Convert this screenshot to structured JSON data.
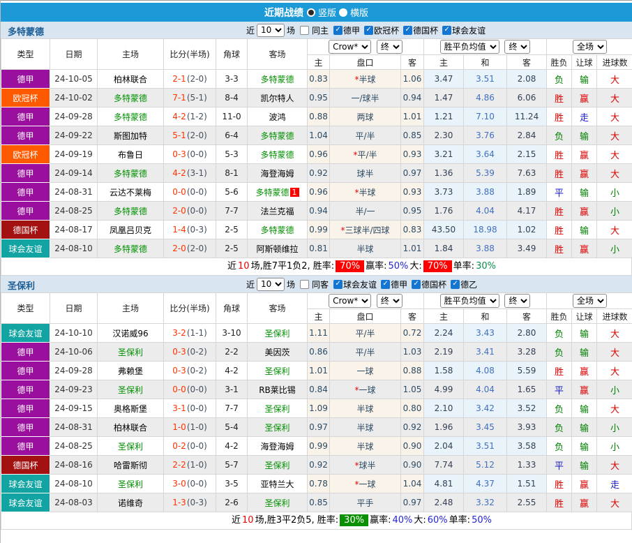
{
  "topbar": {
    "title": "近期战绩",
    "view_options": [
      {
        "label": "竖版",
        "selected": true
      },
      {
        "label": "横版",
        "selected": false
      }
    ]
  },
  "table_header": {
    "main_cols": [
      "类型",
      "日期",
      "主场",
      "比分(半场)",
      "角球",
      "客场"
    ],
    "sub_cols": [
      "主",
      "盘口",
      "客",
      "主",
      "和",
      "客",
      "胜负",
      "让球",
      "进球数"
    ],
    "odds_source_dd": "Crow*",
    "odds_final_dd": "终",
    "avg_dd": "胜平负均值",
    "avg_final_dd": "终",
    "scope_dd": "全场"
  },
  "league_colors": {
    "德甲": "#9a0f9e",
    "欧冠杯": "#ff5a00",
    "德国杯": "#a31111",
    "球会友谊": "#12a3a3"
  },
  "value_colors": {
    "win_red": "#dd0000",
    "draw_blue": "#1a1acc",
    "lose_green": "#008000",
    "topbar_blue": "#1c9ad7",
    "section_bg": "#d9e5f0",
    "highlight_team_green": "#009000",
    "score_red": "#ff3300"
  },
  "sections": [
    {
      "team": "多特蒙德",
      "controls": {
        "near": "近",
        "match_count": "10",
        "unit": "场",
        "same_side": {
          "label": "同主",
          "checked": false
        },
        "leagues": [
          {
            "label": "德甲",
            "checked": true
          },
          {
            "label": "欧冠杯",
            "checked": true
          },
          {
            "label": "德国杯",
            "checked": true
          },
          {
            "label": "球会友谊",
            "checked": true
          }
        ]
      },
      "rows": [
        {
          "league": "德甲",
          "date": "24-10-05",
          "home": "柏林联合",
          "home_hl": false,
          "ft": "2-1",
          "ht": "(2-0)",
          "corner": "3-3",
          "away": "多特蒙德",
          "away_hl": true,
          "away_badge": "",
          "odds_home": "0.83",
          "handicap": "*半球",
          "odds_away": "1.06",
          "avg_home": "3.47",
          "avg_draw": "3.51",
          "avg_away": "2.08",
          "result": "负",
          "handicap_result": "输",
          "goals": "大"
        },
        {
          "league": "欧冠杯",
          "date": "24-10-02",
          "home": "多特蒙德",
          "home_hl": true,
          "ft": "7-1",
          "ht": "(5-1)",
          "corner": "8-4",
          "away": "凯尔特人",
          "away_hl": false,
          "away_badge": "",
          "odds_home": "0.95",
          "handicap": "一/球半",
          "odds_away": "0.94",
          "avg_home": "1.47",
          "avg_draw": "4.86",
          "avg_away": "6.06",
          "result": "胜",
          "handicap_result": "赢",
          "goals": "大"
        },
        {
          "league": "德甲",
          "date": "24-09-28",
          "home": "多特蒙德",
          "home_hl": true,
          "ft": "4-2",
          "ht": "(1-2)",
          "corner": "11-0",
          "away": "波鸿",
          "away_hl": false,
          "away_badge": "",
          "odds_home": "0.88",
          "handicap": "两球",
          "odds_away": "1.01",
          "avg_home": "1.21",
          "avg_draw": "7.10",
          "avg_away": "11.24",
          "result": "胜",
          "handicap_result": "走",
          "goals": "大"
        },
        {
          "league": "德甲",
          "date": "24-09-22",
          "home": "斯图加特",
          "home_hl": false,
          "ft": "5-1",
          "ht": "(2-0)",
          "corner": "6-4",
          "away": "多特蒙德",
          "away_hl": true,
          "away_badge": "",
          "odds_home": "1.04",
          "handicap": "平/半",
          "odds_away": "0.85",
          "avg_home": "2.30",
          "avg_draw": "3.76",
          "avg_away": "2.84",
          "result": "负",
          "handicap_result": "输",
          "goals": "大"
        },
        {
          "league": "欧冠杯",
          "date": "24-09-19",
          "home": "布鲁日",
          "home_hl": false,
          "ft": "0-3",
          "ht": "(0-0)",
          "corner": "5-3",
          "away": "多特蒙德",
          "away_hl": true,
          "away_badge": "",
          "odds_home": "0.96",
          "handicap": "*平/半",
          "odds_away": "0.93",
          "avg_home": "3.21",
          "avg_draw": "3.64",
          "avg_away": "2.15",
          "result": "胜",
          "handicap_result": "赢",
          "goals": "大"
        },
        {
          "league": "德甲",
          "date": "24-09-14",
          "home": "多特蒙德",
          "home_hl": true,
          "ft": "4-2",
          "ht": "(3-1)",
          "corner": "8-1",
          "away": "海登海姆",
          "away_hl": false,
          "away_badge": "",
          "odds_home": "0.92",
          "handicap": "球半",
          "odds_away": "0.97",
          "avg_home": "1.36",
          "avg_draw": "5.39",
          "avg_away": "7.63",
          "result": "胜",
          "handicap_result": "赢",
          "goals": "大"
        },
        {
          "league": "德甲",
          "date": "24-08-31",
          "home": "云达不莱梅",
          "home_hl": false,
          "ft": "0-0",
          "ht": "(0-0)",
          "corner": "5-6",
          "away": "多特蒙德",
          "away_hl": true,
          "away_badge": "1",
          "odds_home": "0.96",
          "handicap": "*半球",
          "odds_away": "0.93",
          "avg_home": "3.73",
          "avg_draw": "3.88",
          "avg_away": "1.89",
          "result": "平",
          "handicap_result": "输",
          "goals": "小"
        },
        {
          "league": "德甲",
          "date": "24-08-25",
          "home": "多特蒙德",
          "home_hl": true,
          "ft": "2-0",
          "ht": "(0-0)",
          "corner": "7-7",
          "away": "法兰克福",
          "away_hl": false,
          "away_badge": "",
          "odds_home": "0.94",
          "handicap": "半/一",
          "odds_away": "0.95",
          "avg_home": "1.76",
          "avg_draw": "4.04",
          "avg_away": "4.17",
          "result": "胜",
          "handicap_result": "赢",
          "goals": "小"
        },
        {
          "league": "德国杯",
          "date": "24-08-17",
          "home": "凤凰吕贝克",
          "home_hl": false,
          "ft": "1-4",
          "ht": "(0-3)",
          "corner": "2-5",
          "away": "多特蒙德",
          "away_hl": true,
          "away_badge": "",
          "odds_home": "0.99",
          "handicap": "*三球半/四球",
          "odds_away": "0.83",
          "avg_home": "43.50",
          "avg_draw": "18.98",
          "avg_away": "1.02",
          "result": "胜",
          "handicap_result": "输",
          "goals": "大"
        },
        {
          "league": "球会友谊",
          "date": "24-08-10",
          "home": "多特蒙德",
          "home_hl": true,
          "ft": "2-0",
          "ht": "(2-0)",
          "corner": "2-5",
          "away": "阿斯顿维拉",
          "away_hl": false,
          "away_badge": "",
          "odds_home": "0.81",
          "handicap": "半球",
          "odds_away": "1.01",
          "avg_home": "1.84",
          "avg_draw": "3.88",
          "avg_away": "3.49",
          "result": "胜",
          "handicap_result": "赢",
          "goals": "小"
        }
      ],
      "summary": [
        {
          "text": "近",
          "style": "plain"
        },
        {
          "text": "10",
          "style": "red-text"
        },
        {
          "text": "场,胜7平1负2, 胜率:",
          "style": "plain"
        },
        {
          "text": "70%",
          "style": "red-badge"
        },
        {
          "text": "赢率:",
          "style": "plain"
        },
        {
          "text": "50%",
          "style": "blue-text"
        },
        {
          "text": "大:",
          "style": "plain"
        },
        {
          "text": "70%",
          "style": "red-badge"
        },
        {
          "text": "单率:",
          "style": "plain"
        },
        {
          "text": "30%",
          "style": "green-text"
        }
      ]
    },
    {
      "team": "圣保利",
      "controls": {
        "near": "近",
        "match_count": "10",
        "unit": "场",
        "same_side": {
          "label": "同客",
          "checked": false
        },
        "leagues": [
          {
            "label": "球会友谊",
            "checked": true
          },
          {
            "label": "德甲",
            "checked": true
          },
          {
            "label": "德国杯",
            "checked": true
          },
          {
            "label": "德乙",
            "checked": true
          }
        ]
      },
      "rows": [
        {
          "league": "球会友谊",
          "date": "24-10-10",
          "home": "汉诺威96",
          "home_hl": false,
          "ft": "3-2",
          "ht": "(1-1)",
          "corner": "3-10",
          "away": "圣保利",
          "away_hl": true,
          "away_badge": "",
          "odds_home": "1.11",
          "handicap": "平/半",
          "odds_away": "0.72",
          "avg_home": "2.24",
          "avg_draw": "3.43",
          "avg_away": "2.80",
          "result": "负",
          "handicap_result": "输",
          "goals": "大"
        },
        {
          "league": "德甲",
          "date": "24-10-06",
          "home": "圣保利",
          "home_hl": true,
          "ft": "0-3",
          "ht": "(0-2)",
          "corner": "2-2",
          "away": "美因茨",
          "away_hl": false,
          "away_badge": "",
          "odds_home": "0.86",
          "handicap": "平/半",
          "odds_away": "1.03",
          "avg_home": "2.19",
          "avg_draw": "3.41",
          "avg_away": "3.28",
          "result": "负",
          "handicap_result": "输",
          "goals": "大"
        },
        {
          "league": "德甲",
          "date": "24-09-28",
          "home": "弗赖堡",
          "home_hl": false,
          "ft": "0-3",
          "ht": "(0-2)",
          "corner": "4-2",
          "away": "圣保利",
          "away_hl": true,
          "away_badge": "",
          "odds_home": "1.01",
          "handicap": "一球",
          "odds_away": "0.88",
          "avg_home": "1.58",
          "avg_draw": "4.08",
          "avg_away": "5.59",
          "result": "胜",
          "handicap_result": "赢",
          "goals": "大"
        },
        {
          "league": "德甲",
          "date": "24-09-23",
          "home": "圣保利",
          "home_hl": true,
          "ft": "0-0",
          "ht": "(0-0)",
          "corner": "3-1",
          "away": "RB莱比锡",
          "away_hl": false,
          "away_badge": "",
          "odds_home": "0.84",
          "handicap": "*一球",
          "odds_away": "1.05",
          "avg_home": "4.99",
          "avg_draw": "4.04",
          "avg_away": "1.65",
          "result": "平",
          "handicap_result": "赢",
          "goals": "小"
        },
        {
          "league": "德甲",
          "date": "24-09-15",
          "home": "奥格斯堡",
          "home_hl": false,
          "ft": "3-1",
          "ht": "(0-0)",
          "corner": "7-7",
          "away": "圣保利",
          "away_hl": true,
          "away_badge": "",
          "odds_home": "1.09",
          "handicap": "半球",
          "odds_away": "0.80",
          "avg_home": "2.10",
          "avg_draw": "3.42",
          "avg_away": "3.52",
          "result": "负",
          "handicap_result": "输",
          "goals": "大"
        },
        {
          "league": "德甲",
          "date": "24-08-31",
          "home": "柏林联合",
          "home_hl": false,
          "ft": "1-0",
          "ht": "(1-0)",
          "corner": "5-4",
          "away": "圣保利",
          "away_hl": true,
          "away_badge": "",
          "odds_home": "0.97",
          "handicap": "半球",
          "odds_away": "0.92",
          "avg_home": "1.96",
          "avg_draw": "3.45",
          "avg_away": "3.93",
          "result": "负",
          "handicap_result": "输",
          "goals": "小"
        },
        {
          "league": "德甲",
          "date": "24-08-25",
          "home": "圣保利",
          "home_hl": true,
          "ft": "0-2",
          "ht": "(0-0)",
          "corner": "4-2",
          "away": "海登海姆",
          "away_hl": false,
          "away_badge": "",
          "odds_home": "0.99",
          "handicap": "半球",
          "odds_away": "0.90",
          "avg_home": "2.04",
          "avg_draw": "3.51",
          "avg_away": "3.58",
          "result": "负",
          "handicap_result": "输",
          "goals": "小"
        },
        {
          "league": "德国杯",
          "date": "24-08-16",
          "home": "哈雷斯彻",
          "home_hl": false,
          "ft": "2-2",
          "ht": "(1-0)",
          "corner": "5-7",
          "away": "圣保利",
          "away_hl": true,
          "away_badge": "",
          "odds_home": "0.92",
          "handicap": "*球半",
          "odds_away": "0.90",
          "avg_home": "7.74",
          "avg_draw": "5.12",
          "avg_away": "1.33",
          "result": "平",
          "handicap_result": "输",
          "goals": "大"
        },
        {
          "league": "球会友谊",
          "date": "24-08-10",
          "home": "圣保利",
          "home_hl": true,
          "ft": "3-0",
          "ht": "(0-0)",
          "corner": "3-5",
          "away": "亚特兰大",
          "away_hl": false,
          "away_badge": "",
          "odds_home": "0.78",
          "handicap": "*一球",
          "odds_away": "1.04",
          "avg_home": "4.81",
          "avg_draw": "4.37",
          "avg_away": "1.51",
          "result": "胜",
          "handicap_result": "赢",
          "goals": "走"
        },
        {
          "league": "球会友谊",
          "date": "24-08-03",
          "home": "诺维奇",
          "home_hl": false,
          "ft": "1-3",
          "ht": "(0-3)",
          "corner": "2-6",
          "away": "圣保利",
          "away_hl": true,
          "away_badge": "",
          "odds_home": "0.85",
          "handicap": "平手",
          "odds_away": "0.97",
          "avg_home": "2.48",
          "avg_draw": "3.32",
          "avg_away": "2.55",
          "result": "胜",
          "handicap_result": "赢",
          "goals": "大"
        }
      ],
      "summary": [
        {
          "text": "近",
          "style": "plain"
        },
        {
          "text": "10",
          "style": "red-text"
        },
        {
          "text": "场,胜3平2负5, 胜率:",
          "style": "plain"
        },
        {
          "text": "30%",
          "style": "green-badge"
        },
        {
          "text": "赢率:",
          "style": "plain"
        },
        {
          "text": "40%",
          "style": "blue-text"
        },
        {
          "text": "大:",
          "style": "plain"
        },
        {
          "text": "60%",
          "style": "blue-text"
        },
        {
          "text": "单率:",
          "style": "plain"
        },
        {
          "text": "50%",
          "style": "blue-text"
        }
      ]
    }
  ]
}
